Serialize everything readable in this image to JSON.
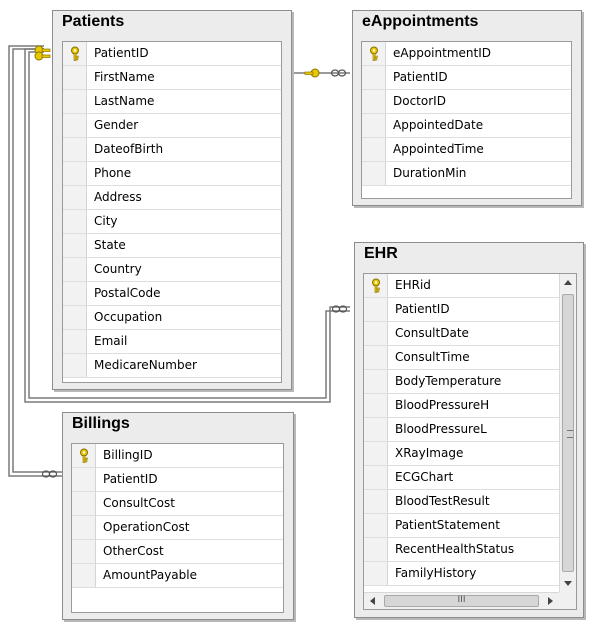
{
  "tables": [
    {
      "id": "patients",
      "title": "Patients",
      "columns": [
        "PatientID",
        "FirstName",
        "LastName",
        "Gender",
        "DateofBirth",
        "Phone",
        "Address",
        "City",
        "State",
        "Country",
        "PostalCode",
        "Occupation",
        "Email",
        "MedicareNumber"
      ],
      "primary_key": "PatientID"
    },
    {
      "id": "eappointments",
      "title": "eAppointments",
      "columns": [
        "eAppointmentID",
        "PatientID",
        "DoctorID",
        "AppointedDate",
        "AppointedTime",
        "DurationMin"
      ],
      "primary_key": "eAppointmentID"
    },
    {
      "id": "ehr",
      "title": "EHR",
      "columns": [
        "EHRid",
        "PatientID",
        "ConsultDate",
        "ConsultTime",
        "BodyTemperature",
        "BloodPressureH",
        "BloodPressureL",
        "XRayImage",
        "ECGChart",
        "BloodTestResult",
        "PatientStatement",
        "RecentHealthStatus",
        "FamilyHistory"
      ],
      "primary_key": "EHRid"
    },
    {
      "id": "billings",
      "title": "Billings",
      "columns": [
        "BillingID",
        "PatientID",
        "ConsultCost",
        "OperationCost",
        "OtherCost",
        "AmountPayable"
      ],
      "primary_key": "BillingID"
    }
  ],
  "relationships": [
    {
      "from": "patients",
      "to": "eappointments",
      "one_end": "key-icon",
      "many_end": "infinity-icon"
    },
    {
      "from": "patients",
      "to": "ehr",
      "one_end": "key-icon",
      "many_end": "infinity-icon"
    },
    {
      "from": "patients",
      "to": "billings",
      "one_end": "key-icon",
      "many_end": "infinity-icon"
    }
  ],
  "colors": {
    "key": "#e8c800",
    "line": "#7a7a7a",
    "panel": "#ececec"
  },
  "scrollbars": {
    "ehr": {
      "vertical": true,
      "horizontal": true,
      "h_glyph": "III"
    }
  }
}
